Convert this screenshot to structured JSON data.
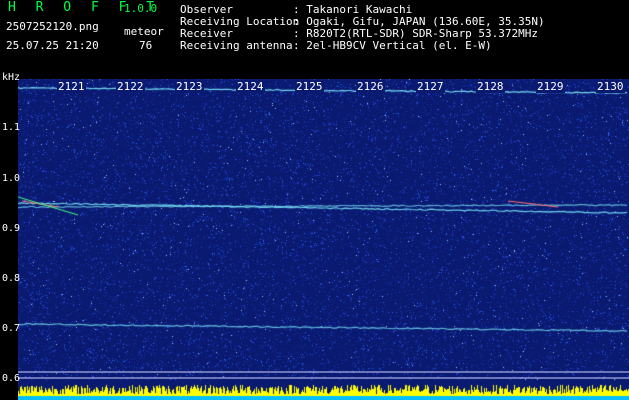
{
  "app": {
    "title": "H R O F F T",
    "version": "1.0.0"
  },
  "capture": {
    "file_name": "2507252120.png",
    "date_time": "25.07.25 21:20"
  },
  "meteor": {
    "label": "meteor",
    "count": "76"
  },
  "info": [
    {
      "label": "Observer",
      "value": ": Takanori Kawachi"
    },
    {
      "label": "Receiving Location",
      "value": ": Ogaki, Gifu, JAPAN (136.60E, 35.35N)"
    },
    {
      "label": "Receiver",
      "value": ": R820T2(RTL-SDR) SDR-Sharp 53.372MHz"
    },
    {
      "label": "Receiving antenna",
      "value": ": 2el-HB9CV Vertical (el. E-W)"
    }
  ],
  "chart_data": {
    "type": "heatmap",
    "ylabel": "kHz",
    "y_ticks": [
      "1.1",
      "1.0",
      "0.9",
      "0.8",
      "0.7",
      "0.6"
    ],
    "x_ticks": [
      "2121",
      "2122",
      "2123",
      "2124",
      "2125",
      "2126",
      "2127",
      "2128",
      "2129",
      "2130"
    ],
    "colors": {
      "background": "#0a1a70",
      "noise": "#2a5cff",
      "trace": "#7ff0ff",
      "level": "#ffff00",
      "axis_text": "#ffffff",
      "header_text": "#00ff40"
    }
  }
}
